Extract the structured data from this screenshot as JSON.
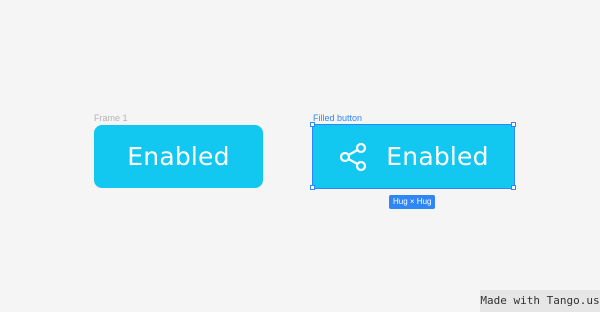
{
  "canvas": {
    "background": "#f5f5f5"
  },
  "frame1": {
    "label": "Frame 1",
    "button_text": "Enabled",
    "color": "#12c7f0"
  },
  "selected": {
    "label": "Filled button",
    "button_text": "Enabled",
    "icon": "share-icon",
    "size_badge": "Hug × Hug",
    "selection_color": "#2f86f6"
  },
  "watermark": {
    "text": "Made with Tango.us"
  }
}
